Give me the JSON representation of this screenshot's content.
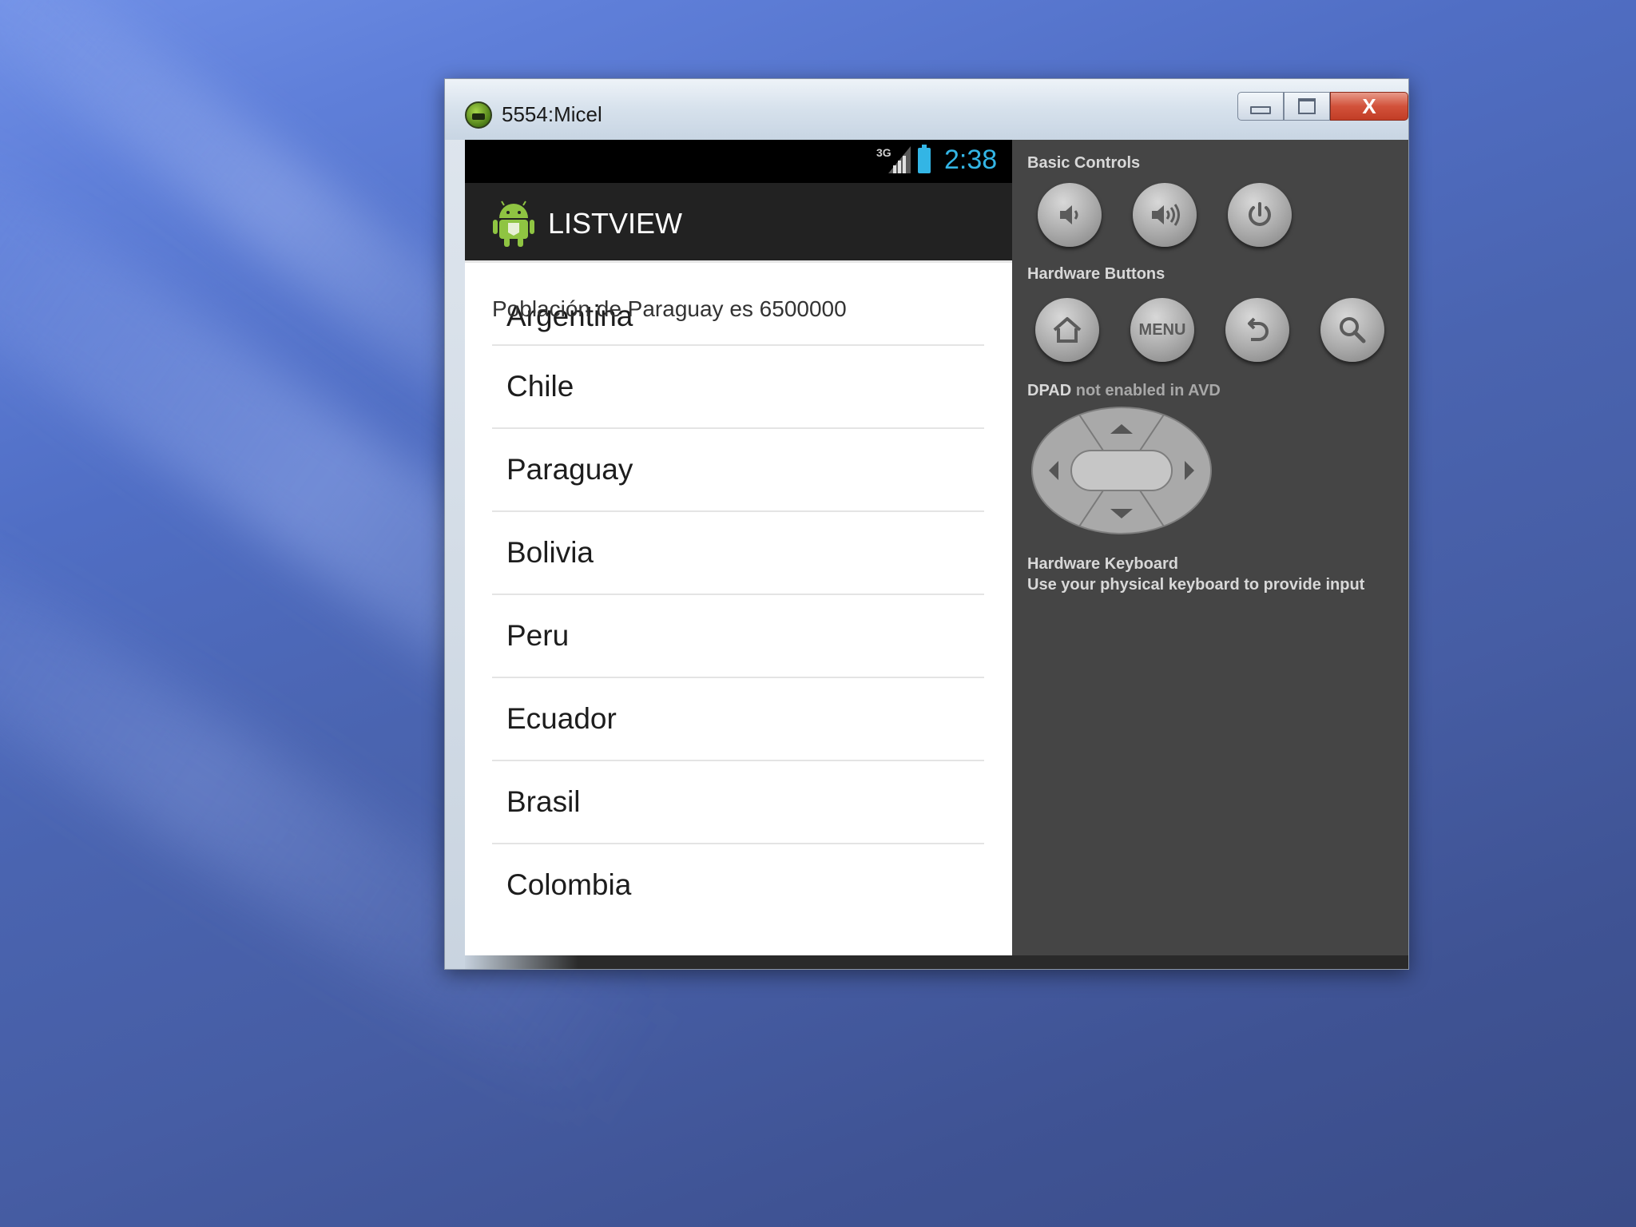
{
  "window": {
    "title": "5554:Micel",
    "close_label": "X"
  },
  "statusbar": {
    "network": "3G",
    "time": "2:38"
  },
  "actionbar": {
    "title": "LISTVIEW"
  },
  "toast": {
    "text": "Población de Paraguay es 6500000"
  },
  "list": {
    "items": [
      "Argentina",
      "Chile",
      "Paraguay",
      "Bolivia",
      "Peru",
      "Ecuador",
      "Brasil",
      "Colombia"
    ]
  },
  "controls": {
    "basic_label": "Basic Controls",
    "hardware_label": "Hardware Buttons",
    "menu_label": "MENU",
    "dpad_label": "DPAD",
    "dpad_note": "not enabled in AVD",
    "keyboard_label": "Hardware Keyboard",
    "keyboard_note": "Use your physical keyboard to provide input"
  },
  "icons": {
    "basic": [
      "volume-down-icon",
      "volume-up-icon",
      "power-icon"
    ],
    "hardware": [
      "home-icon",
      "menu",
      "back-icon",
      "search-icon"
    ]
  },
  "colors": {
    "accent_blue": "#33b5e5",
    "panel_bg": "#454545",
    "actionbar_bg": "#222222",
    "close_red": "#c23d26"
  }
}
